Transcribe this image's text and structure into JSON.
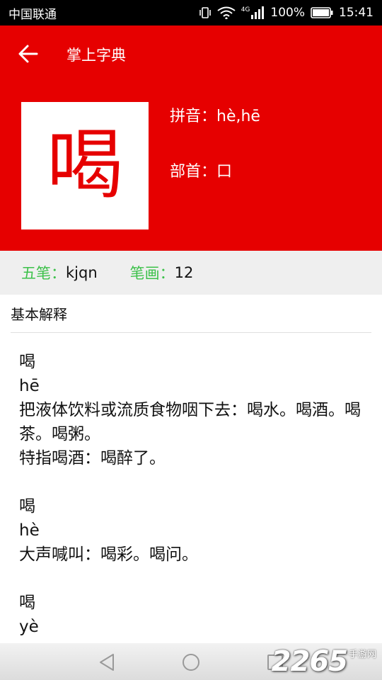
{
  "status_bar": {
    "carrier": "中国联通",
    "network": "4G",
    "battery": "100%",
    "time": "15:41"
  },
  "app": {
    "title": "掌上字典"
  },
  "character": {
    "glyph": "喝",
    "pinyin_label": "拼音：",
    "pinyin_value": "hè,hē",
    "radical_label": "部首：",
    "radical_value": "口"
  },
  "stats": {
    "wubi_label": "五笔：",
    "wubi_value": "kjqn",
    "strokes_label": "笔画：",
    "strokes_value": "12"
  },
  "section": {
    "title": "基本解释"
  },
  "entries": [
    {
      "char": "喝",
      "pinyin": "hē",
      "lines": [
        "把液体饮料或流质食物咽下去：喝水。喝酒。喝茶。喝粥。",
        "特指喝酒：喝醉了。"
      ]
    },
    {
      "char": "喝",
      "pinyin": "hè",
      "lines": [
        "大声喊叫：喝彩。喝问。"
      ]
    },
    {
      "char": "喝",
      "pinyin": "yè",
      "lines": []
    }
  ],
  "watermark": {
    "number": "2265",
    "sub": "手游网"
  },
  "icons": {
    "back": "back-arrow-icon",
    "signal": "signal-icon",
    "wifi": "wifi-icon",
    "battery": "battery-icon"
  },
  "colors": {
    "brand_red": "#e60000",
    "label_green": "#3cc14a"
  }
}
